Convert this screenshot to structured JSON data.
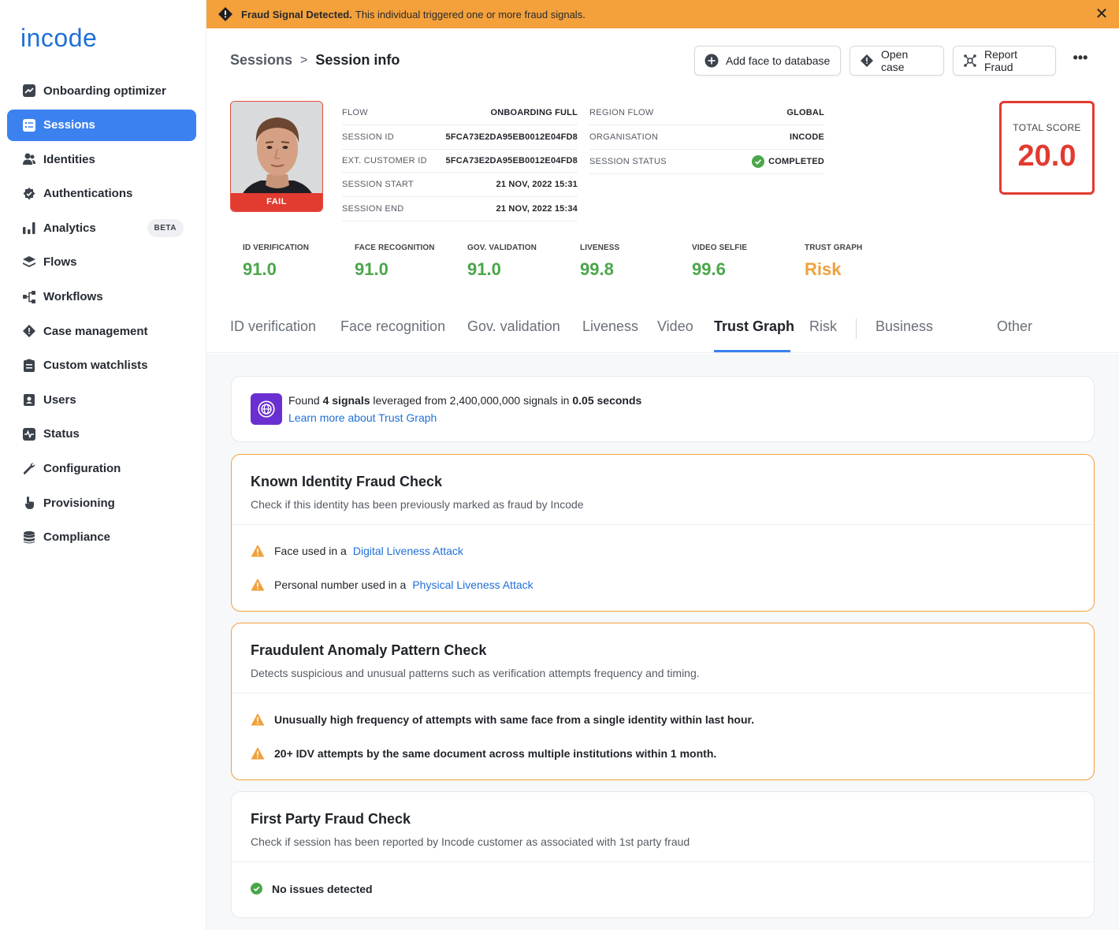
{
  "app": {
    "logo": "incode"
  },
  "banner": {
    "title": "Fraud Signal Detected.",
    "message": "This individual triggered one or more fraud signals.",
    "color": "#f4a13c"
  },
  "sidebar": {
    "items": [
      {
        "label": "Onboarding optimizer",
        "icon": "trend-chart-icon"
      },
      {
        "label": "Sessions",
        "icon": "list-icon",
        "active": true
      },
      {
        "label": "Identities",
        "icon": "users-icon"
      },
      {
        "label": "Authentications",
        "icon": "badge-check-icon"
      },
      {
        "label": "Analytics",
        "icon": "bar-chart-icon",
        "badge": "BETA"
      },
      {
        "label": "Flows",
        "icon": "layers-icon"
      },
      {
        "label": "Workflows",
        "icon": "workflow-icon"
      },
      {
        "label": "Case management",
        "icon": "alert-octagon-icon"
      },
      {
        "label": "Custom watchlists",
        "icon": "clipboard-list-icon"
      },
      {
        "label": "Users",
        "icon": "id-badge-icon"
      },
      {
        "label": "Status",
        "icon": "pulse-icon"
      },
      {
        "label": "Configuration",
        "icon": "wrench-icon"
      },
      {
        "label": "Provisioning",
        "icon": "hand-pointer-icon"
      },
      {
        "label": "Compliance",
        "icon": "database-icon"
      }
    ]
  },
  "header": {
    "breadcrumb_parent": "Sessions",
    "breadcrumb_sep": ">",
    "breadcrumb_current": "Session info",
    "add_face_label": "Add face to database",
    "open_case_label": "Open case",
    "report_fraud_label": "Report Fraud",
    "more_label": "•••"
  },
  "photo": {
    "status": "FAIL"
  },
  "session": {
    "left": [
      {
        "key": "FLOW",
        "value": "ONBOARDING FULL"
      },
      {
        "key": "SESSION ID",
        "value": "5FCA73E2DA95EB0012E04FD8"
      },
      {
        "key": "EXT. CUSTOMER ID",
        "value": "5FCA73E2DA95EB0012E04FD8"
      },
      {
        "key": "SESSION START",
        "value": "21 NOV, 2022 15:31"
      },
      {
        "key": "SESSION END",
        "value": "21 NOV, 2022 15:34"
      }
    ],
    "right": [
      {
        "key": "REGION FLOW",
        "value": "GLOBAL"
      },
      {
        "key": "ORGANISATION",
        "value": "INCODE"
      },
      {
        "key": "SESSION STATUS",
        "value": "COMPLETED"
      }
    ]
  },
  "total_score": {
    "label": "TOTAL SCORE",
    "value": "20.0"
  },
  "scores": [
    {
      "label": "ID VERIFICATION",
      "value": "91.0"
    },
    {
      "label": "FACE RECOGNITION",
      "value": "91.0"
    },
    {
      "label": "GOV. VALIDATION",
      "value": "91.0"
    },
    {
      "label": "LIVENESS",
      "value": "99.8"
    },
    {
      "label": "VIDEO SELFIE",
      "value": "99.6"
    },
    {
      "label": "TRUST GRAPH",
      "value": "Risk"
    }
  ],
  "tabs": [
    {
      "label": "ID verification"
    },
    {
      "label": "Face recognition"
    },
    {
      "label": "Gov. validation"
    },
    {
      "label": "Liveness"
    },
    {
      "label": "Video"
    },
    {
      "label": "Trust Graph",
      "active": true
    },
    {
      "label": "Risk"
    },
    {
      "label": "Business"
    },
    {
      "label": "Other"
    }
  ],
  "trust_graph": {
    "found_prefix": "Found",
    "found_count": "4 signals",
    "found_middle": "leveraged from 2,400,000,000 signals in",
    "found_time": "0.05 seconds",
    "learn_more": "Learn more about Trust Graph"
  },
  "checks": [
    {
      "title": "Known Identity Fraud Check",
      "subtitle": "Check if this identity has been previously marked as fraud by Incode",
      "signals": [
        {
          "text": "Face used in a",
          "link": "Digital Liveness Attack"
        },
        {
          "text": "Personal number used in a",
          "link": "Physical Liveness Attack"
        }
      ]
    },
    {
      "title": "Fraudulent Anomaly Pattern Check",
      "subtitle": "Detects suspicious and unusual patterns such as verification attempts frequency and timing.",
      "signals": [
        {
          "text": "Unusually high frequency of attempts with same face from a single identity within last hour."
        },
        {
          "text": "20+ IDV attempts by the same document across multiple institutions within 1 month."
        }
      ]
    },
    {
      "title": "First Party Fraud Check",
      "subtitle": "Check if session has been reported by Incode customer as associated with 1st party fraud",
      "signals": [
        {
          "text": "No issues detected"
        }
      ]
    }
  ],
  "colors": {
    "accent": "#3b82f0",
    "danger": "#e23b30",
    "success": "#4aa64a",
    "warning": "#f0a13c"
  }
}
